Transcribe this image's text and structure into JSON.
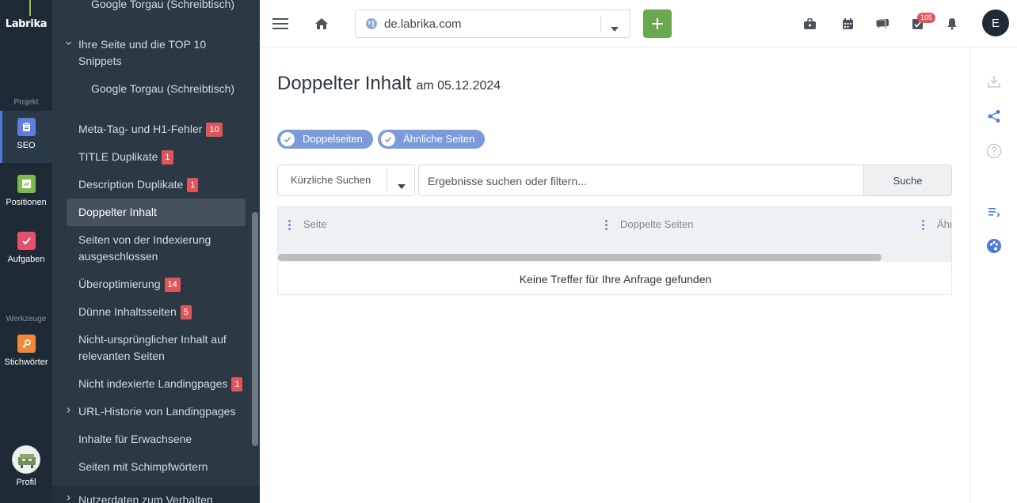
{
  "brand": {
    "logo_text": "Labrika"
  },
  "rail": {
    "section_project": "Projekt",
    "section_tools": "Werkzeuge",
    "items": [
      {
        "label": "SEO",
        "color": "#5d7fe0"
      },
      {
        "label": "Positionen",
        "color": "#7dba4e"
      },
      {
        "label": "Aufgaben",
        "color": "#e6506e"
      },
      {
        "label": "Stichwörter",
        "color": "#f08a3a"
      }
    ],
    "profile_label": "Profil"
  },
  "subnav": {
    "items": [
      {
        "label": "Google Torgau (Schreibtisch)",
        "badge": ""
      },
      {
        "label": "Ihre Seite und die TOP 10 Snippets",
        "badge": ""
      },
      {
        "label": "Google Torgau (Schreibtisch)",
        "badge": ""
      },
      {
        "label": "Meta-Tag- und H1-Fehler",
        "badge": "10"
      },
      {
        "label": "TITLE Duplikate",
        "badge": "1"
      },
      {
        "label": "Description Duplikate",
        "badge": "1"
      },
      {
        "label": "Doppelter Inhalt",
        "badge": ""
      },
      {
        "label": "Seiten von der Indexierung ausgeschlossen",
        "badge": ""
      },
      {
        "label": "Überoptimierung",
        "badge": "14"
      },
      {
        "label": "Dünne Inhaltsseiten",
        "badge": "5"
      },
      {
        "label": "Nicht-ursprünglicher Inhalt auf relevanten Seiten",
        "badge": ""
      },
      {
        "label": "Nicht indexierte Landingpages",
        "badge": "1"
      },
      {
        "label": "URL-Historie von Landingpages",
        "badge": ""
      },
      {
        "label": "Inhalte für Erwachsene",
        "badge": ""
      },
      {
        "label": "Seiten mit Schimpfwörtern",
        "badge": ""
      },
      {
        "label": "Nutzerdaten zum Verhalten",
        "badge": ""
      }
    ]
  },
  "topbar": {
    "domain": "de.labrika.com",
    "notification_count": "105",
    "user_initial": "E"
  },
  "page": {
    "title": "Doppelter Inhalt",
    "date_text": "am 05.12.2024",
    "chips": [
      "Doppelseiten",
      "Ähnliche Seiten"
    ],
    "recent_search_label": "Kürzliche Suchen",
    "filter_placeholder": "Ergebnisse suchen oder filtern...",
    "search_button": "Suche",
    "columns": [
      "Seite",
      "Doppelte Seiten",
      "Ähn"
    ],
    "empty_text": "Keine Treffer für Ihre Anfrage gefunden"
  },
  "colors": {
    "accent": "#7c9bdb",
    "add_button": "#6aa84f",
    "badge": "#e0555a",
    "rail_bg": "#1e2b36",
    "subnav_bg": "#2b3945"
  }
}
